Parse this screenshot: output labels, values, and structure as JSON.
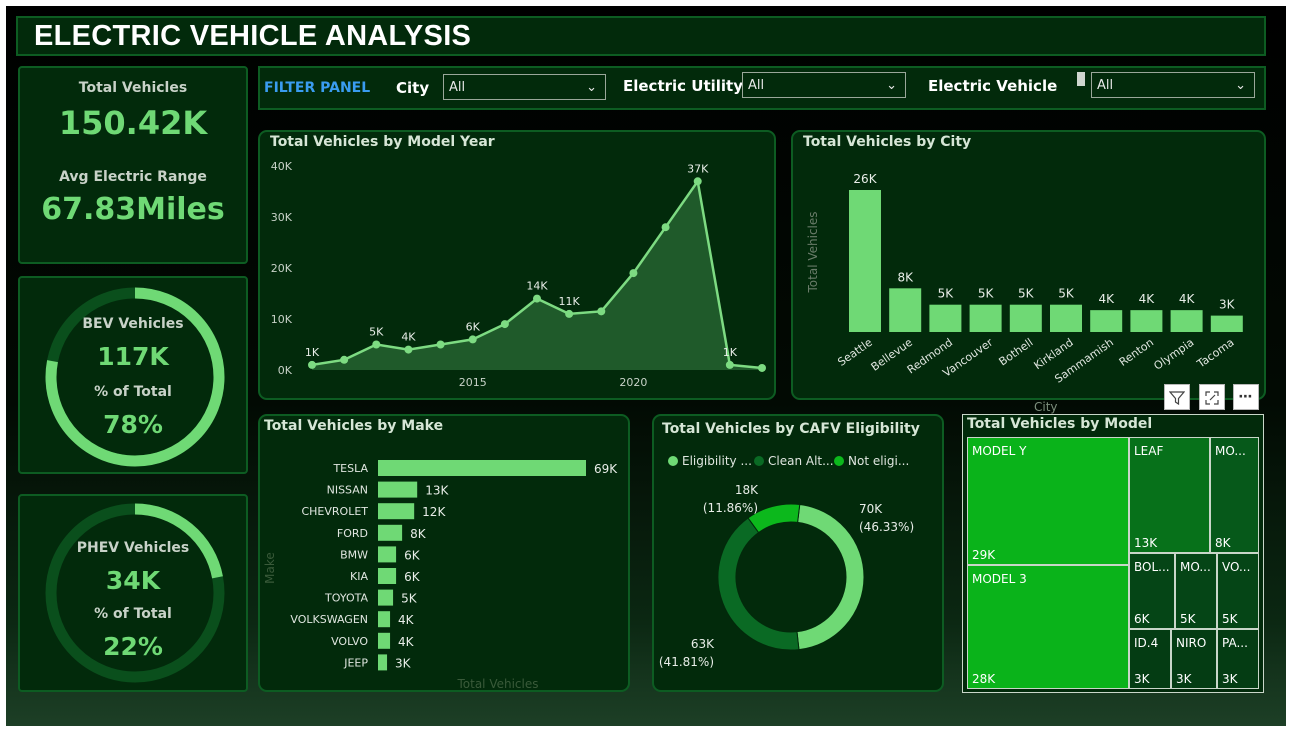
{
  "title": "ELECTRIC VEHICLE ANALYSIS",
  "kpi": {
    "total_vehicles_label": "Total Vehicles",
    "total_vehicles_value": "150.42K",
    "avg_range_label": "Avg Electric Range",
    "avg_range_value": "67.83Miles"
  },
  "bev": {
    "label": "BEV Vehicles",
    "value": "117K",
    "pct_label": "% of Total",
    "pct_value": "78%",
    "fraction": 0.78
  },
  "phev": {
    "label": "PHEV Vehicles",
    "value": "34K",
    "pct_label": "% of Total",
    "pct_value": "22%",
    "fraction": 0.22
  },
  "filters": {
    "panel_label": "FILTER PANEL",
    "city_label": "City",
    "city_value": "All",
    "utility_label": "Electric Utility",
    "utility_value": "All",
    "ev_label": "Electric Vehicle",
    "ev_value": "All"
  },
  "chart_data": [
    {
      "type": "area",
      "title": "Total Vehicles by Model Year",
      "x": [
        2010,
        2011,
        2012,
        2013,
        2014,
        2015,
        2016,
        2017,
        2018,
        2019,
        2020,
        2021,
        2022,
        2023,
        2024
      ],
      "values": [
        1,
        2,
        5,
        4,
        5,
        6,
        9,
        14,
        11,
        11.5,
        19,
        28,
        37,
        1,
        0.4
      ],
      "data_labels": [
        "1K",
        "",
        "5K",
        "4K",
        "",
        "6K",
        "",
        "14K",
        "11K",
        "",
        "",
        "",
        "37K",
        "1K",
        ""
      ],
      "ylim": [
        0,
        40
      ],
      "y_ticks": [
        "0K",
        "10K",
        "20K",
        "30K",
        "40K"
      ],
      "x_ticks": [
        "2015",
        "2020"
      ]
    },
    {
      "type": "bar",
      "title": "Total Vehicles by City",
      "categories": [
        "Seattle",
        "Bellevue",
        "Redmond",
        "Vancouver",
        "Bothell",
        "Kirkland",
        "Sammamish",
        "Renton",
        "Olympia",
        "Tacoma"
      ],
      "values": [
        26,
        8,
        5,
        5,
        5,
        5,
        4,
        4,
        4,
        3
      ],
      "data_labels": [
        "26K",
        "8K",
        "5K",
        "5K",
        "5K",
        "5K",
        "4K",
        "4K",
        "4K",
        "3K"
      ],
      "ylabel": "Total Vehicles",
      "xlabel": "City",
      "ylim": [
        0,
        26
      ]
    },
    {
      "type": "bar",
      "orientation": "horizontal",
      "title": "Total Vehicles by Make",
      "categories": [
        "TESLA",
        "NISSAN",
        "CHEVROLET",
        "FORD",
        "BMW",
        "KIA",
        "TOYOTA",
        "VOLKSWAGEN",
        "VOLVO",
        "JEEP"
      ],
      "values": [
        69,
        13,
        12,
        8,
        6,
        6,
        5,
        4,
        4,
        3
      ],
      "data_labels": [
        "69K",
        "13K",
        "12K",
        "8K",
        "6K",
        "6K",
        "5K",
        "4K",
        "4K",
        "3K"
      ],
      "ylabel": "Make",
      "xlabel": "Total Vehicles"
    },
    {
      "type": "pie",
      "donut": true,
      "title": "Total Vehicles by CAFV Eligibility",
      "legend": [
        "Eligibility ...",
        "Clean Alt...",
        "Not eligi..."
      ],
      "values": [
        70,
        63,
        18
      ],
      "value_labels": [
        "70K",
        "63K",
        "18K"
      ],
      "percent_labels": [
        "(46.33%)",
        "(41.81%)",
        "(11.86%)"
      ],
      "colors": [
        "#6fd975",
        "#0a6a24",
        "#0cb81c"
      ]
    },
    {
      "type": "treemap",
      "title": "Total Vehicles by Model",
      "categories": [
        "MODEL Y",
        "MODEL 3",
        "LEAF",
        "MO...",
        "BOL...",
        "MO...",
        "VO...",
        "ID.4",
        "NIRO",
        "PA..."
      ],
      "value_labels": [
        "29K",
        "28K",
        "13K",
        "8K",
        "6K",
        "5K",
        "5K",
        "3K",
        "3K",
        "3K"
      ],
      "values": [
        29,
        28,
        13,
        8,
        6,
        5,
        5,
        3,
        3,
        3
      ]
    }
  ],
  "icons": {
    "filter": "filter-icon",
    "focus": "focus-mode-icon",
    "more": "more-options-icon"
  }
}
